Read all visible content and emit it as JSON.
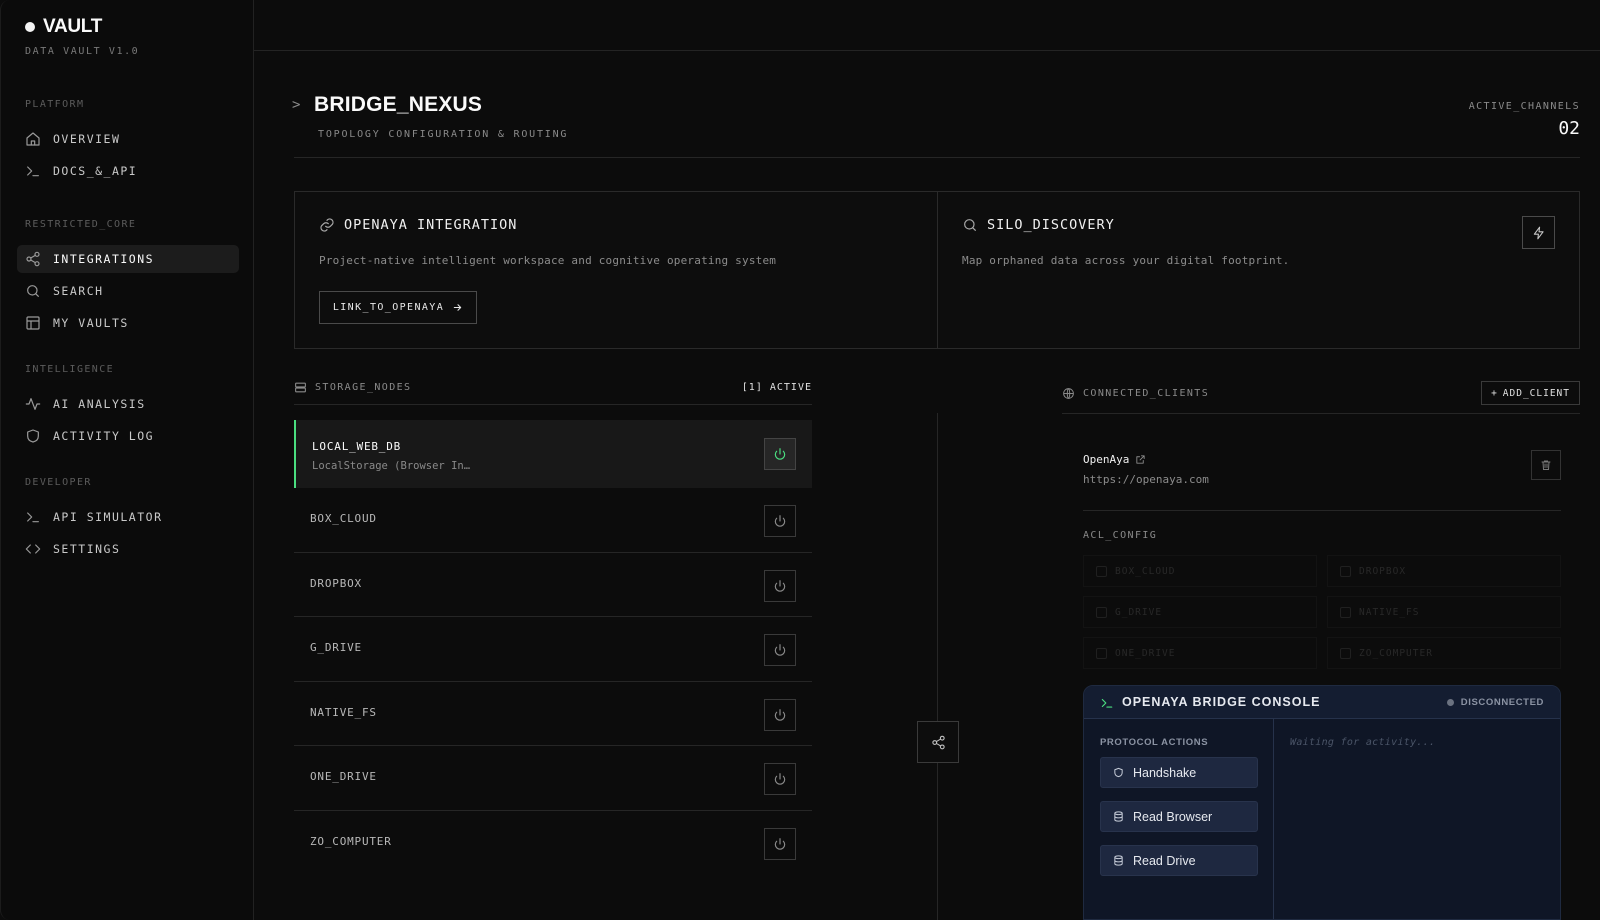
{
  "sidebar": {
    "brand": "VAULT",
    "version": "DATA VAULT V1.0",
    "sections": [
      {
        "title": "PLATFORM",
        "items": [
          {
            "label": "OVERVIEW",
            "icon": "home-icon"
          },
          {
            "label": "DOCS_&_API",
            "icon": "terminal-icon"
          }
        ]
      },
      {
        "title": "RESTRICTED_CORE",
        "items": [
          {
            "label": "INTEGRATIONS",
            "icon": "share-icon",
            "active": true
          },
          {
            "label": "SEARCH",
            "icon": "search-icon"
          },
          {
            "label": "MY VAULTS",
            "icon": "layout-icon"
          }
        ]
      },
      {
        "title": "INTELLIGENCE",
        "items": [
          {
            "label": "AI ANALYSIS",
            "icon": "activity-icon"
          },
          {
            "label": "ACTIVITY LOG",
            "icon": "shield-icon"
          }
        ]
      },
      {
        "title": "DEVELOPER",
        "items": [
          {
            "label": "API SIMULATOR",
            "icon": "terminal-icon"
          },
          {
            "label": "SETTINGS",
            "icon": "code-icon"
          }
        ]
      }
    ]
  },
  "header": {
    "title": "BRIDGE_NEXUS",
    "subtitle": "TOPOLOGY CONFIGURATION & ROUTING",
    "metric_label": "ACTIVE_CHANNELS",
    "metric_value": "02"
  },
  "cards": {
    "openaya": {
      "title": "OPENAYA INTEGRATION",
      "description": "Project-native intelligent workspace and cognitive operating system",
      "button": "LINK_TO_OPENAYA"
    },
    "silo": {
      "title": "SILO_DISCOVERY",
      "description": "Map orphaned data across your digital footprint."
    }
  },
  "storage": {
    "title": "STORAGE_NODES",
    "count": "[1] ACTIVE",
    "nodes": [
      {
        "name": "LOCAL_WEB_DB",
        "desc": "LocalStorage (Browser In…",
        "active": true
      },
      {
        "name": "BOX_CLOUD"
      },
      {
        "name": "DROPBOX"
      },
      {
        "name": "G_DRIVE"
      },
      {
        "name": "NATIVE_FS"
      },
      {
        "name": "ONE_DRIVE"
      },
      {
        "name": "ZO_COMPUTER"
      }
    ]
  },
  "clients": {
    "title": "CONNECTED_CLIENTS",
    "add_button": "ADD_CLIENT",
    "client": {
      "name": "OpenAya",
      "url": "https://openaya.com"
    },
    "acl_title": "ACL_CONFIG",
    "acl": [
      "BOX_CLOUD",
      "DROPBOX",
      "G_DRIVE",
      "NATIVE_FS",
      "ONE_DRIVE",
      "ZO_COMPUTER"
    ]
  },
  "console": {
    "title": "OPENAYA BRIDGE CONSOLE",
    "status": "DISCONNECTED",
    "actions_label": "PROTOCOL ACTIONS",
    "actions": [
      "Handshake",
      "Read Browser",
      "Read Drive"
    ],
    "log_placeholder": "Waiting for activity..."
  },
  "colors": {
    "accent_green": "#4ade80",
    "console_bg": "#0f1626",
    "background": "#0c0c0c"
  }
}
